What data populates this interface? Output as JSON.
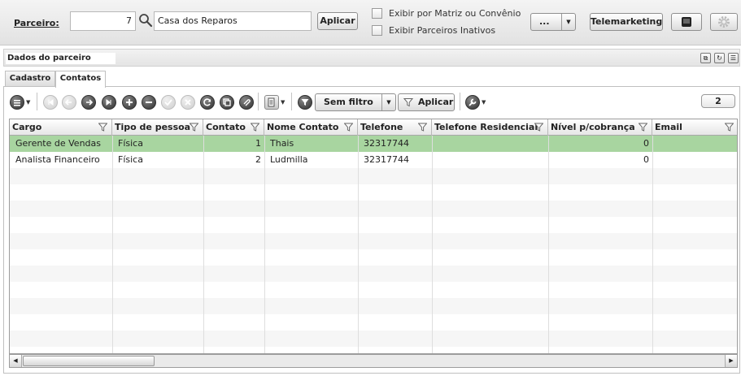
{
  "filter_bar": {
    "parceiro_label": "Parceiro:",
    "parceiro_code": "7",
    "parceiro_name": "Casa dos Reparos",
    "apply_label": "Aplicar",
    "check_matriz_label": "Exibir por Matriz ou Convênio",
    "check_inativos_label": "Exibir Parceiros Inativos",
    "more_label": "...",
    "telemarketing_label": "Telemarketing"
  },
  "panel": {
    "title": "Dados do parceiro"
  },
  "tabs": [
    {
      "label": "Cadastro",
      "active": false
    },
    {
      "label": "Contatos",
      "active": true
    }
  ],
  "toolbar": {
    "filter_select_label": "Sem filtro",
    "apply_label": "Aplicar",
    "record_count": "2"
  },
  "grid": {
    "columns": [
      "Cargo",
      "Tipo de pessoa",
      "Contato",
      "Nome Contato",
      "Telefone",
      "Telefone Residencial",
      "Nível p/cobrança",
      "Email"
    ],
    "rows": [
      {
        "cargo": "Gerente de Vendas",
        "tipo": "Física",
        "contato": "1",
        "nome": "Thais",
        "telefone": "32317744",
        "tel_res": "",
        "nivel": "0",
        "email": "",
        "selected": true
      },
      {
        "cargo": "Analista Financeiro",
        "tipo": "Física",
        "contato": "2",
        "nome": "Ludmilla",
        "telefone": "32317744",
        "tel_res": "",
        "nivel": "0",
        "email": "",
        "selected": false
      }
    ]
  },
  "colors": {
    "selected_row": "#a8d5a0",
    "alt_row": "#f6f6f6"
  }
}
